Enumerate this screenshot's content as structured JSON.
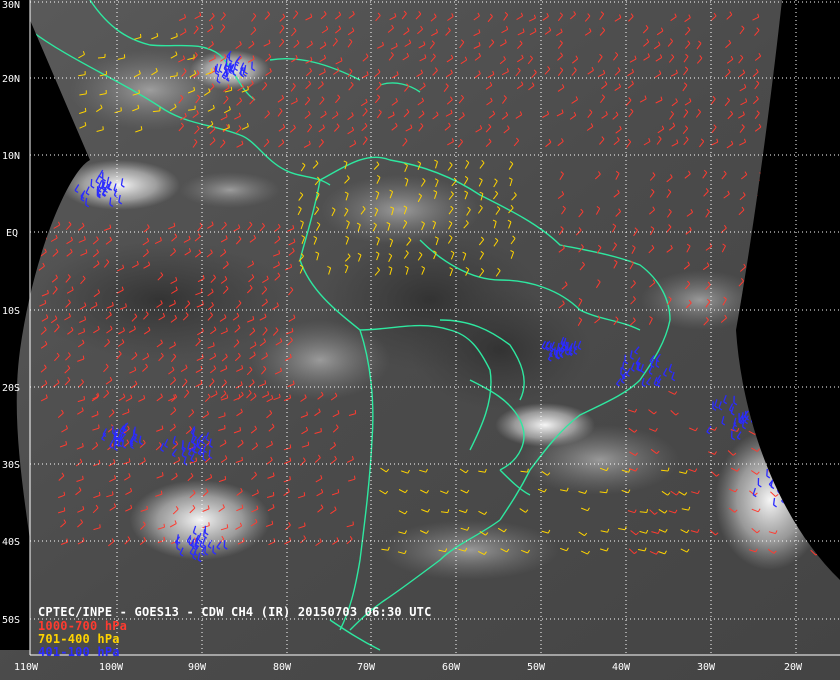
{
  "caption": {
    "title": "CPTEC/INPE - GOES13 - CDW CH4 (IR) 20150703 06:30 UTC",
    "legend": [
      {
        "label": "1000-700 hPa",
        "color": "#ff3b30"
      },
      {
        "label": "701-400 hPa",
        "color": "#ffd400"
      },
      {
        "label": "401-100 hPa",
        "color": "#2b2bff"
      }
    ]
  },
  "grid": {
    "latitude_labels": [
      "30N",
      "20N",
      "10N",
      "EQ",
      "10S",
      "20S",
      "30S",
      "40S",
      "50S"
    ],
    "longitude_labels": [
      "110W",
      "100W",
      "90W",
      "80W",
      "70W",
      "60W",
      "50W",
      "40W",
      "30W",
      "20W"
    ],
    "line_color": "#ffffff"
  },
  "colors": {
    "coastline": "#2ee8a0",
    "background": "#000000"
  }
}
